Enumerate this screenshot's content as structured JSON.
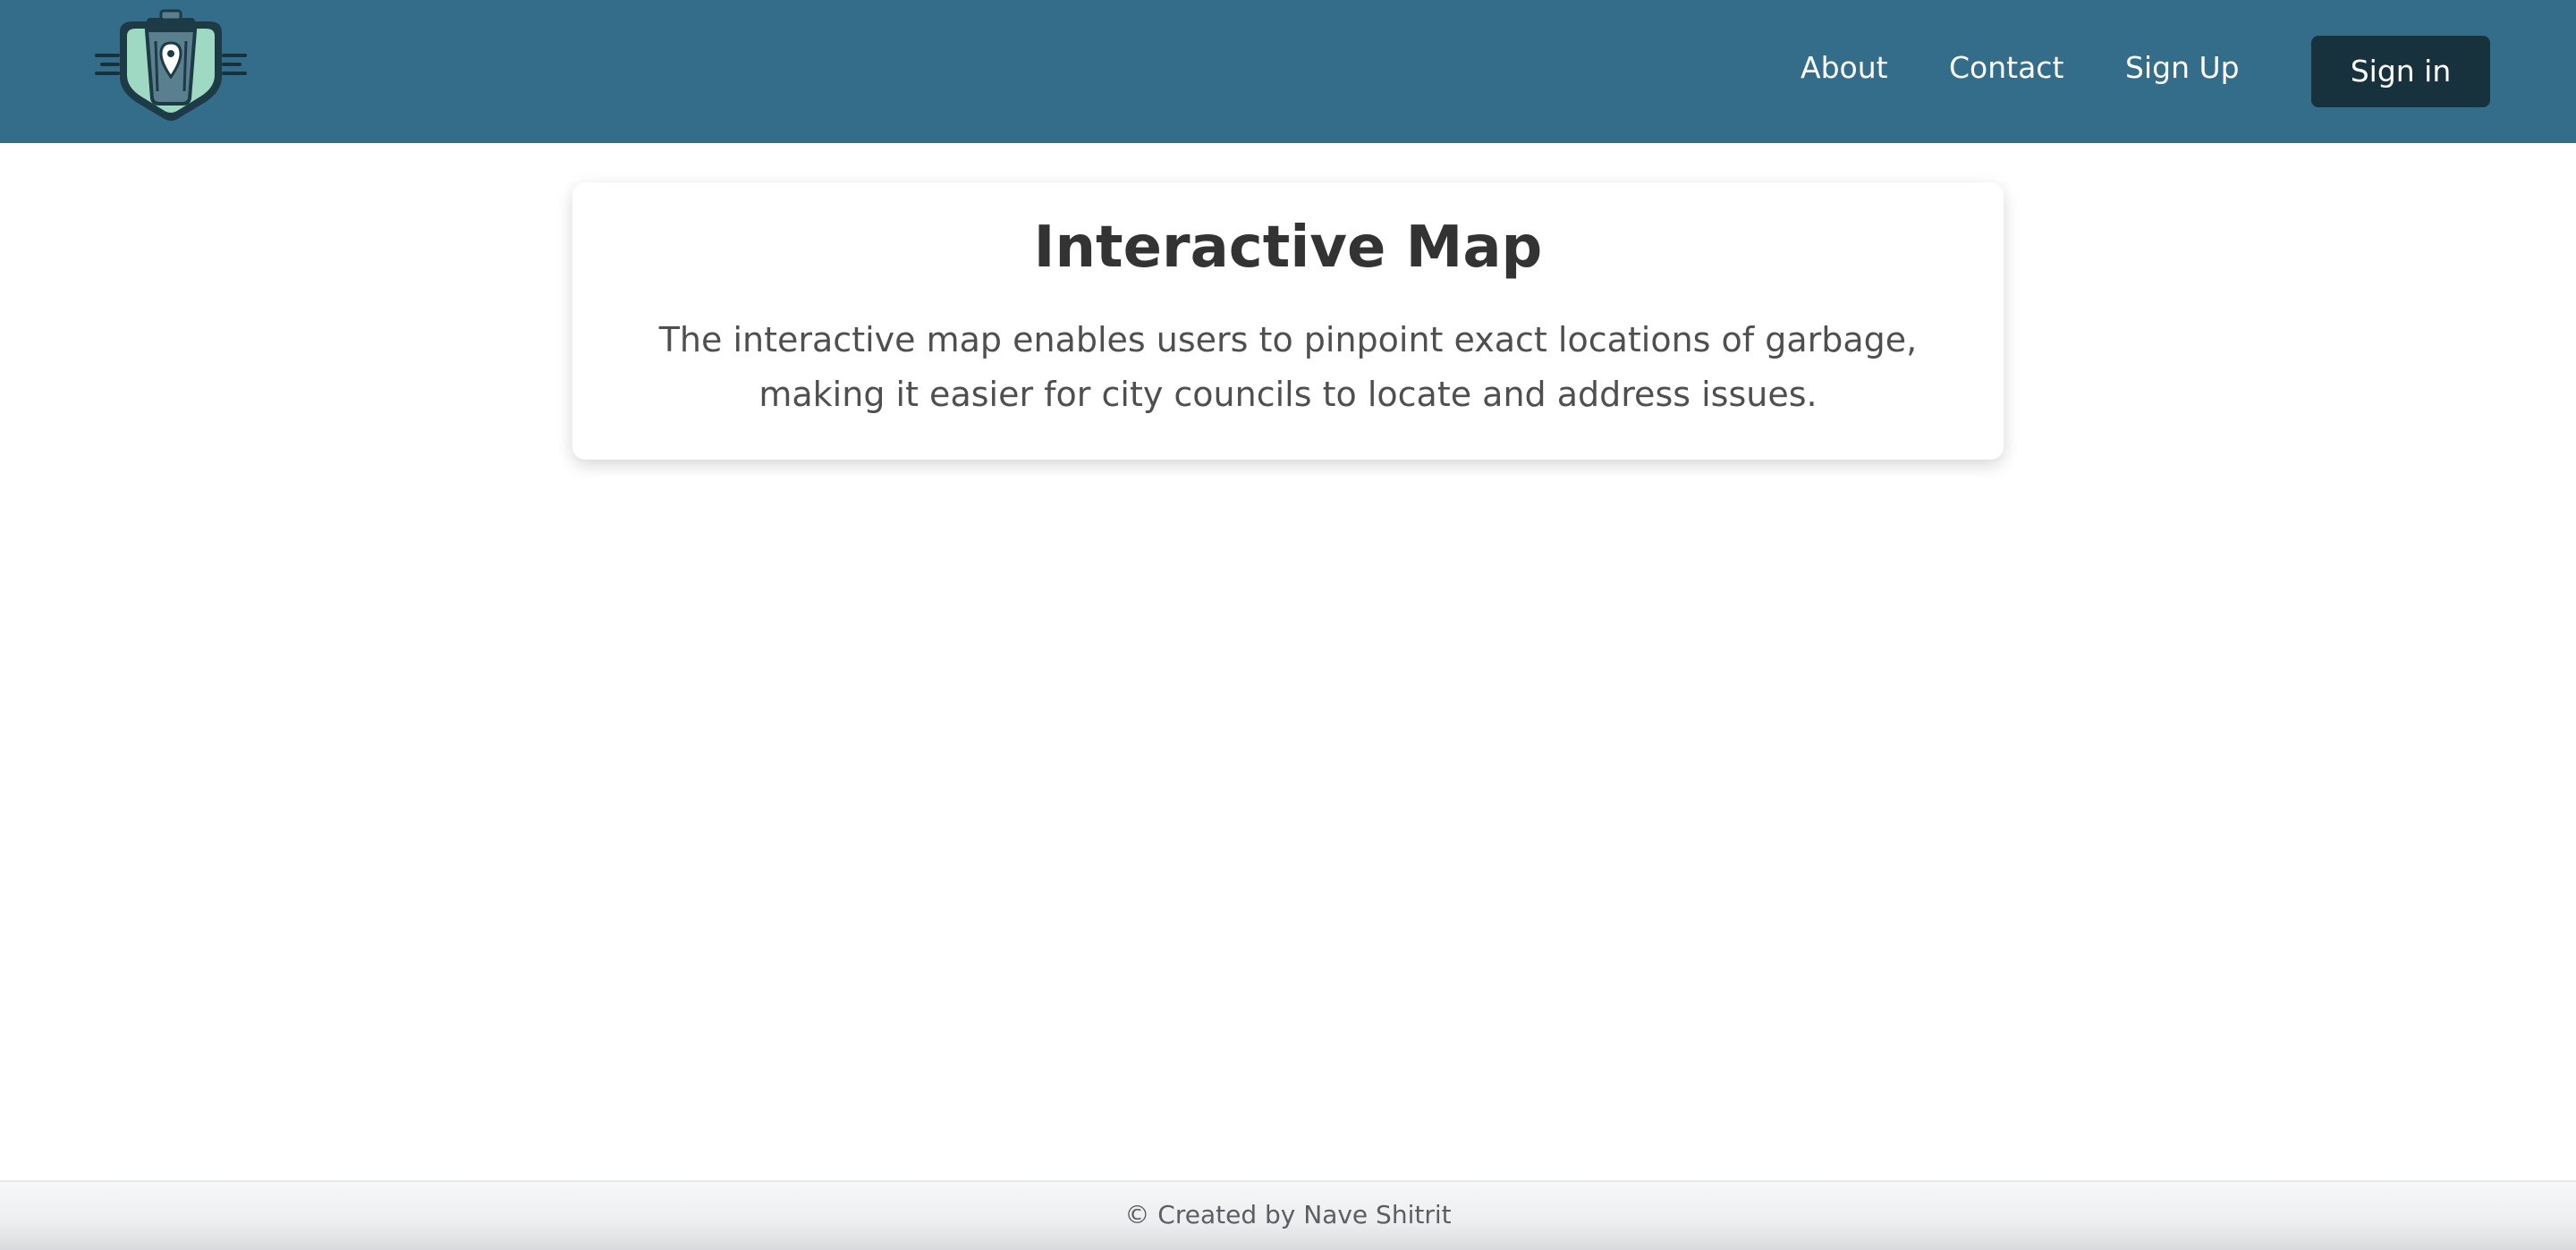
{
  "header": {
    "logo_icon": "trash-bin-location-pin-logo",
    "nav": {
      "about": "About",
      "contact": "Contact",
      "signup": "Sign Up",
      "signin": "Sign in"
    }
  },
  "card": {
    "title": "Interactive Map",
    "description": "The interactive map enables users to pinpoint exact locations of garbage, making it easier for city councils to locate and address issues."
  },
  "footer": {
    "text": "© Created by Nave Shitrit"
  },
  "colors": {
    "navbar": "#336d8a",
    "signin_button": "#17313d",
    "title_text": "#333333"
  }
}
